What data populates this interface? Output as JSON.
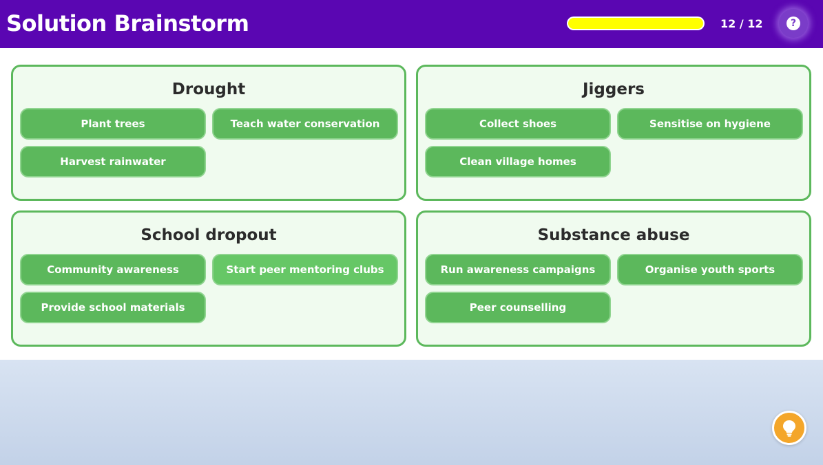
{
  "app": {
    "title": "Solution Brainstorm"
  },
  "progress": {
    "label": "12 / 12",
    "fraction": 1.0,
    "fill_color": "#ffff00"
  },
  "icons": {
    "help": "help-icon",
    "hint": "lightbulb-icon"
  },
  "colors": {
    "header": "#5a06b2",
    "chip": "#5cb85c",
    "panel_bg": "#f0fbef",
    "hint": "#f4a62a"
  },
  "categories": [
    {
      "title": "Drought",
      "items": [
        "Plant trees",
        "Teach water conservation",
        "Harvest rainwater"
      ]
    },
    {
      "title": "Jiggers",
      "items": [
        "Collect shoes",
        "Sensitise on hygiene",
        "Clean village homes"
      ]
    },
    {
      "title": "School dropout",
      "items": [
        "Community awareness",
        "Start peer mentoring clubs",
        "Provide school materials"
      ]
    },
    {
      "title": "Substance abuse",
      "items": [
        "Run awareness campaigns",
        "Organise youth sports",
        "Peer counselling"
      ]
    }
  ],
  "help_glyph": "?"
}
